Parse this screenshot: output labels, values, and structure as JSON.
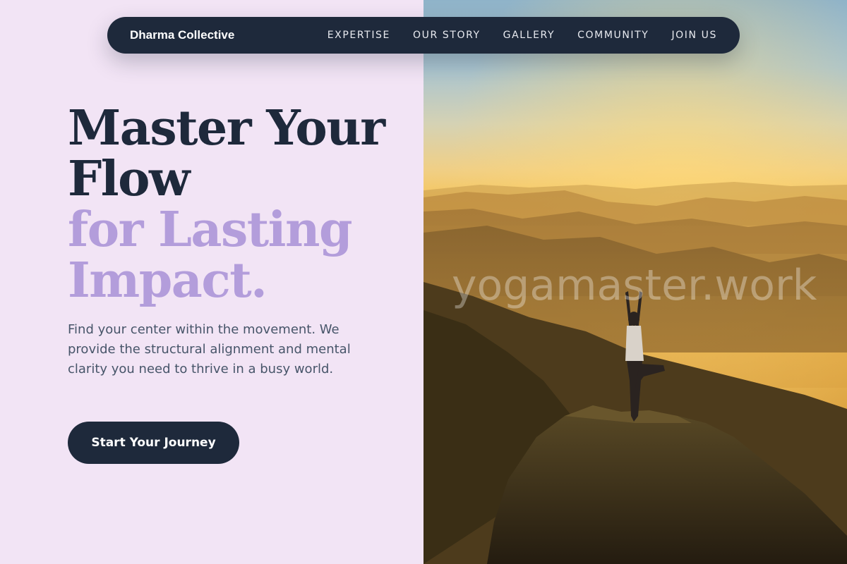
{
  "nav": {
    "brand": "Dharma Collective",
    "links": [
      "EXPERTISE",
      "OUR STORY",
      "GALLERY",
      "COMMUNITY",
      "JOIN US"
    ]
  },
  "hero": {
    "headline_line1": "Master Your",
    "headline_line2": "Flow",
    "headline_accent_line1": "for Lasting",
    "headline_accent_line2": "Impact.",
    "description": "Find your center within the movement. We provide the structural alignment and mental clarity you need to thrive in a busy world.",
    "cta_label": "Start Your Journey"
  },
  "image": {
    "watermark": "yogamaster.work"
  },
  "colors": {
    "left_background": "#f2e4f5",
    "nav_background": "#1e293b",
    "headline_dark": "#1e293b",
    "headline_accent": "#b39ddb",
    "body_text": "#475569"
  }
}
